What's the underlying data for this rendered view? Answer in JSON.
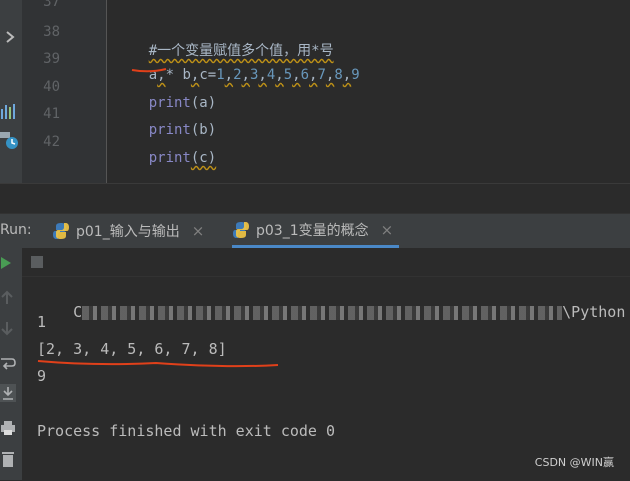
{
  "editor": {
    "line_numbers": [
      "37",
      "38",
      "39",
      "40",
      "41",
      "42"
    ],
    "lines": [
      {
        "comment": "#一个变量赋值多个值，用*号"
      },
      {
        "p1": "a",
        "p2": ",",
        "p3": "* b",
        "p4": ",",
        "p5": "c=",
        "nums": [
          "1",
          "2",
          "3",
          "4",
          "5",
          "6",
          "7",
          "8",
          "9"
        ]
      },
      {
        "func": "print",
        "args": "(a)"
      },
      {
        "func": "print",
        "args": "(b)"
      },
      {
        "func": "print",
        "args": "(c)"
      }
    ]
  },
  "run": {
    "label": "Run:",
    "tabs": [
      {
        "label": "p01_输入与输出"
      },
      {
        "label": "p03_1变量的概念"
      }
    ],
    "close_glyph": "×"
  },
  "console": {
    "path_prefix": "C",
    "path_suffix": "\\Python",
    "lines": [
      "1",
      "[2, 3, 4, 5, 6, 7, 8]",
      "9",
      "Process finished with exit code 0"
    ]
  },
  "watermark": "CSDN @WIN赢",
  "colors": {
    "accent_tab": "#4a88c7",
    "annotation_red": "#e0401a",
    "run_green": "#499c54",
    "python_blue": "#3d7ab8",
    "python_yellow": "#f2c744"
  }
}
